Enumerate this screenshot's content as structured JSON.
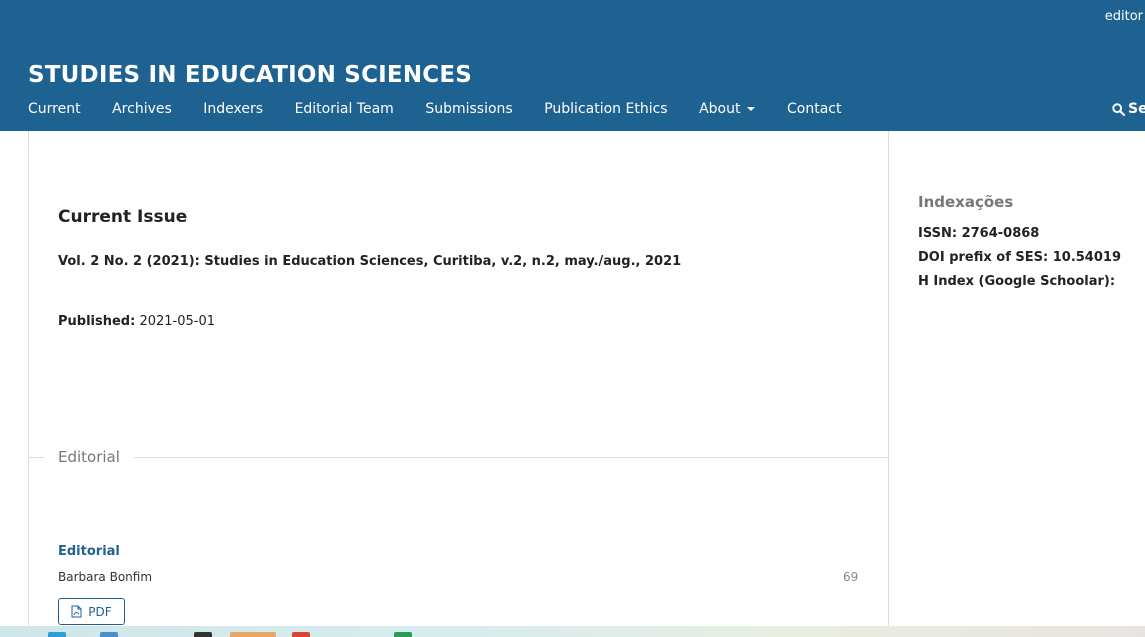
{
  "header": {
    "user_link": "editor",
    "site_title": "STUDIES IN EDUCATION SCIENCES",
    "nav": {
      "current": "Current",
      "archives": "Archives",
      "indexers": "Indexers",
      "editorial_team": "Editorial Team",
      "submissions": "Submissions",
      "publication_ethics": "Publication Ethics",
      "about": "About",
      "contact": "Contact"
    },
    "search_label": "Se"
  },
  "main": {
    "heading": "Current Issue",
    "issue_title": "Vol. 2 No. 2 (2021): Studies in Education Sciences, Curitiba, v.2, n.2, may./aug., 2021",
    "published_label": "Published:",
    "published_date": "2021-05-01",
    "section_title": "Editorial",
    "article": {
      "title": "Editorial",
      "author": "Barbara Bonfim",
      "pages": "69",
      "pdf_label": "PDF"
    }
  },
  "sidebar": {
    "title": "Indexações",
    "issn": "ISSN: 2764-0868",
    "doi_prefix": "DOI prefix of SES: 10.54019",
    "h_index": "H Index (Google Schoolar):"
  },
  "colors": {
    "header_bg": "#1e6292",
    "link": "#1e6292"
  }
}
